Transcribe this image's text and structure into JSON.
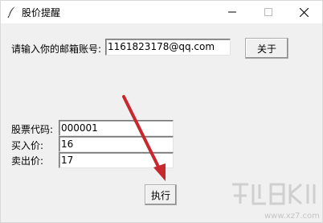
{
  "window": {
    "title": "股价提醒",
    "icon": "feather-icon",
    "controls": {
      "minimize": "minimize-icon",
      "maximize": "maximize-icon",
      "close": "close-icon"
    }
  },
  "email": {
    "label": "请输入你的邮箱账号:",
    "value": "1161823178@qq.com"
  },
  "about_button": "关于",
  "stock": {
    "code_label": "股票代码:",
    "code_value": "000001",
    "buy_label": "买入价:",
    "buy_value": "16",
    "sell_label": "卖出价:",
    "sell_value": "17"
  },
  "execute_button": "执行",
  "annotation": {
    "arrow_color": "#c8282d"
  },
  "watermark": {
    "domain": "www.xz7.com"
  }
}
